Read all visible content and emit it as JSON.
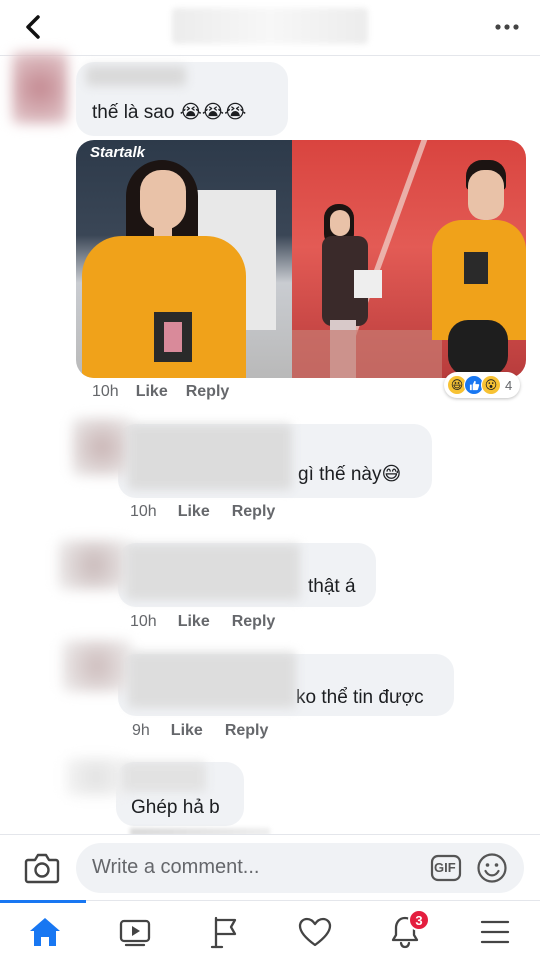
{
  "header": {
    "back_icon": "chevron-left-icon",
    "more_icon": "more-horizontal-icon"
  },
  "comments": [
    {
      "text": "thế là sao 😭😭😭",
      "time": "10h",
      "like": "Like",
      "reply": "Reply"
    },
    {
      "text": "gì thế này😅",
      "time": "10h",
      "like": "Like",
      "reply": "Reply"
    },
    {
      "text": "thật á",
      "time": "10h",
      "like": "Like",
      "reply": "Reply"
    },
    {
      "text": "ko thể tin được",
      "time": "9h",
      "like": "Like",
      "reply": "Reply"
    },
    {
      "text": "Ghép hả b"
    }
  ],
  "photo": {
    "watermark": "Startalk"
  },
  "reactions": {
    "icons": [
      "haha-icon",
      "like-icon",
      "wow-icon"
    ],
    "count": "4"
  },
  "composer": {
    "placeholder": "Write a comment...",
    "gif_label": "GIF"
  },
  "tabbar": {
    "items": [
      "home-icon",
      "watch-icon",
      "pages-flag-icon",
      "dating-heart-icon",
      "notifications-bell-icon",
      "menu-icon"
    ],
    "notification_badge": "3"
  },
  "colors": {
    "accent": "#1877f2",
    "bubble": "#f0f2f5",
    "badge": "#e41e3f",
    "meta": "#65676b"
  }
}
